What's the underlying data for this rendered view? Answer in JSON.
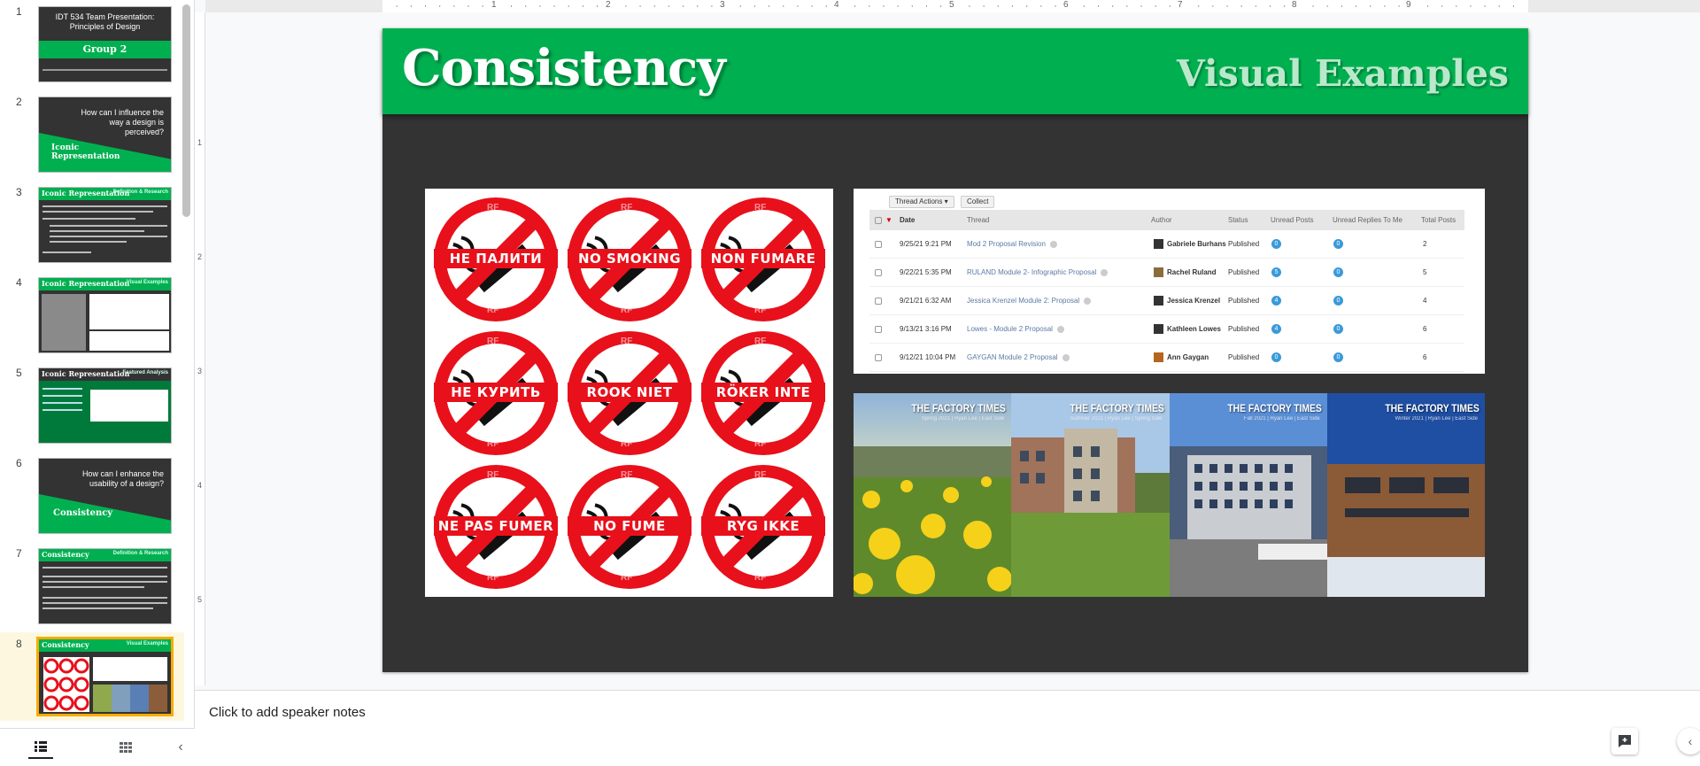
{
  "filmstrip": {
    "slides": [
      {
        "num": "1",
        "title": "IDT 534 Team Presentation: Principles of Design",
        "tag": "Group 2"
      },
      {
        "num": "2",
        "title": "How can I influence the way a design is perceived?",
        "tag": "Iconic Representation"
      },
      {
        "num": "3",
        "title": "Iconic Representation",
        "tag": "Definition & Research"
      },
      {
        "num": "4",
        "title": "Iconic Representation",
        "tag": "Visual Examples"
      },
      {
        "num": "5",
        "title": "Iconic Representation",
        "tag": "Featured Analysis"
      },
      {
        "num": "6",
        "title": "How can I enhance the usability of a design?",
        "tag": "Consistency"
      },
      {
        "num": "7",
        "title": "Consistency",
        "tag": "Definition & Research"
      },
      {
        "num": "8",
        "title": "Consistency",
        "tag": "Visual Examples"
      }
    ],
    "selected": "8"
  },
  "ruler": {
    "top_labels": [
      "1",
      "2",
      "3",
      "4",
      "5",
      "6",
      "7",
      "8",
      "9"
    ],
    "left_labels": [
      "1",
      "2",
      "3",
      "4",
      "5"
    ]
  },
  "slide": {
    "title": "Consistency",
    "subtitle": "Visual Examples",
    "signs": [
      "НЕ ПАЛИТИ",
      "NO SMOKING",
      "NON FUMARE",
      "НЕ КУРИТЬ",
      "ROOK NIET",
      "RÖKER INTE",
      "NE PAS FUMER",
      "NO FUME",
      "RYG IKKE"
    ],
    "watermark": "RF",
    "table": {
      "actions_label": "Thread Actions",
      "collect_label": "Collect",
      "headers": [
        "Date",
        "Thread",
        "Author",
        "Status",
        "Unread Posts",
        "Unread Replies To Me",
        "Total Posts"
      ],
      "rows": [
        {
          "date": "9/25/21 9:21 PM",
          "thread": "Mod 2 Proposal Revision",
          "author": "Gabriele Burhans",
          "status": "Published",
          "unread": "0",
          "replies": "0",
          "total": "2"
        },
        {
          "date": "9/22/21 5:35 PM",
          "thread": "RULAND Module 2- Infographic Proposal",
          "author": "Rachel Ruland",
          "status": "Published",
          "unread": "5",
          "replies": "0",
          "total": "5"
        },
        {
          "date": "9/21/21 6:32 AM",
          "thread": "Jessica Krenzel Module 2: Proposal",
          "author": "Jessica Krenzel",
          "status": "Published",
          "unread": "4",
          "replies": "0",
          "total": "4"
        },
        {
          "date": "9/13/21 3:16 PM",
          "thread": "Lowes - Module 2 Proposal",
          "author": "Kathleen Lowes",
          "status": "Published",
          "unread": "4",
          "replies": "0",
          "total": "6"
        },
        {
          "date": "9/12/21 10:04 PM",
          "thread": "GAYGAN Module 2 Proposal",
          "author": "Ann Gaygan",
          "status": "Published",
          "unread": "0",
          "replies": "0",
          "total": "6"
        }
      ]
    },
    "photos": [
      {
        "title": "THE FACTORY TIMES",
        "sub": "Spring 2021 | Ryan Lee | East Side"
      },
      {
        "title": "THE FACTORY TIMES",
        "sub": "Summer 2021 | Ryan Lee | Spring Side"
      },
      {
        "title": "THE FACTORY TIMES",
        "sub": "Fall 2021 | Ryan Lee | East Side"
      },
      {
        "title": "THE FACTORY TIMES",
        "sub": "Winter 2021 | Ryan Lee | East Side"
      }
    ]
  },
  "notes": {
    "placeholder": "Click to add speaker notes"
  },
  "colors": {
    "accent_green": "#00b050",
    "slide_bg": "#333333",
    "sign_red": "#e8101a",
    "selection": "#f9ab00"
  }
}
